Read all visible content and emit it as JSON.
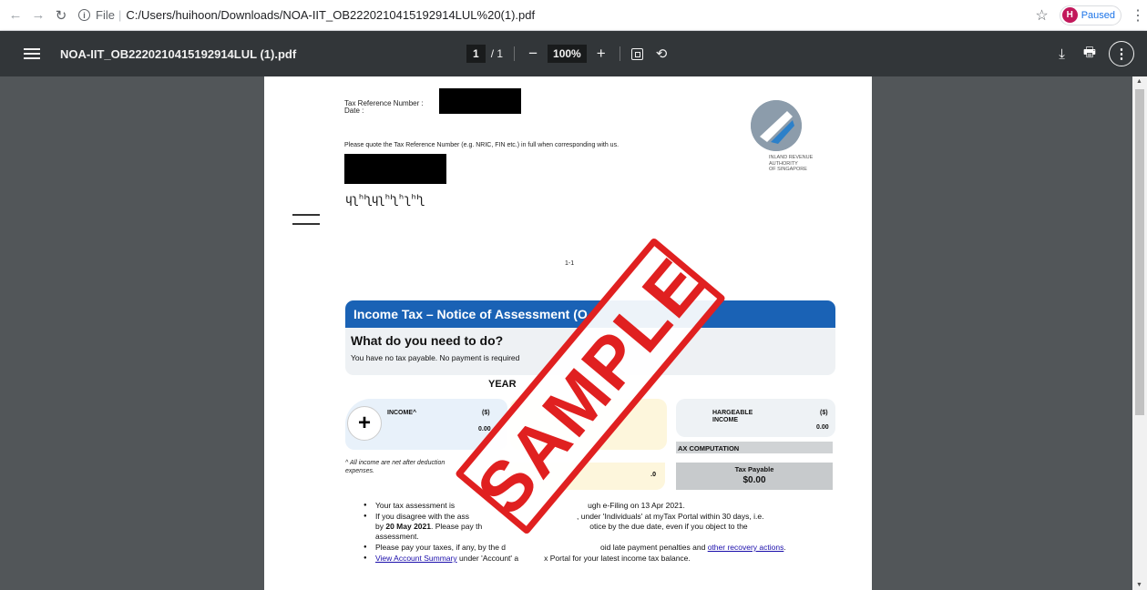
{
  "browser": {
    "url_scheme": "File",
    "url": "C:/Users/huihoon/Downloads/NOA-IIT_OB2220210415192914LUL%20(1).pdf",
    "profile_initial": "H",
    "profile_status": "Paused"
  },
  "toolbar": {
    "title": "NOA-IIT_OB2220210415192914LUL (1).pdf",
    "page_current": "1",
    "page_total": "/ 1",
    "zoom": "100%"
  },
  "document": {
    "ref_label": "Tax Reference Number :",
    "date_label": "Date :",
    "quote_text": "Please quote the Tax Reference Number (e.g. NRIC, FIN etc.) in full when corresponding with us.",
    "barcode": "ɥʅʰᑊʅɥʅʰᑊʅʰʅʰᑊʅ",
    "iras_line1": "INLAND REVENUE",
    "iras_line2": "AUTHORITY",
    "iras_line3": "OF SINGAPORE",
    "page_num": "1-1",
    "banner_title": "Income Tax – Notice of Assessment (O",
    "todo_title": "What do you need to do?",
    "todo_text": "You have no tax payable. No payment is required",
    "year_label": "YEAR ",
    "income_label": "INCOME^",
    "income_unit": "($)",
    "income_value": "0.00",
    "chargeable_label_1": "HARGEABLE",
    "chargeable_label_2": "INCOME",
    "chargeable_unit": "($)",
    "chargeable_value": "0.00",
    "footnote_1": "^ All income are net after deduction",
    "footnote_2": "expenses.",
    "comp_head": "AX COMPUTATION",
    "mid_fragment": ".0",
    "payable_label": "Tax Payable",
    "payable_value": "$0.00",
    "bullet1_a": "Your tax assessment is",
    "bullet1_b": "ugh e-Filing on 13 Apr 2021.",
    "bullet2_a": "If you disagree with the ass",
    "bullet2_b": ", under 'Individuals' at myTax Portal within 30 days, i.e.",
    "bullet2_c": "by",
    "bullet2_date": "20 May 2021",
    "bullet2_d": ". Please pay th",
    "bullet2_e": "otice by the due date, even if you object to the",
    "bullet2_f": "assessment.",
    "bullet3_a": "Please pay your taxes, if any, by the d",
    "bullet3_b": "oid late payment penalties and",
    "bullet3_link": "other recovery actions",
    "bullet4_link": "View Account Summary",
    "bullet4_a": "under 'Account' a",
    "bullet4_b": "x Portal for your latest income tax balance.",
    "stamp": "SAMPLE"
  }
}
